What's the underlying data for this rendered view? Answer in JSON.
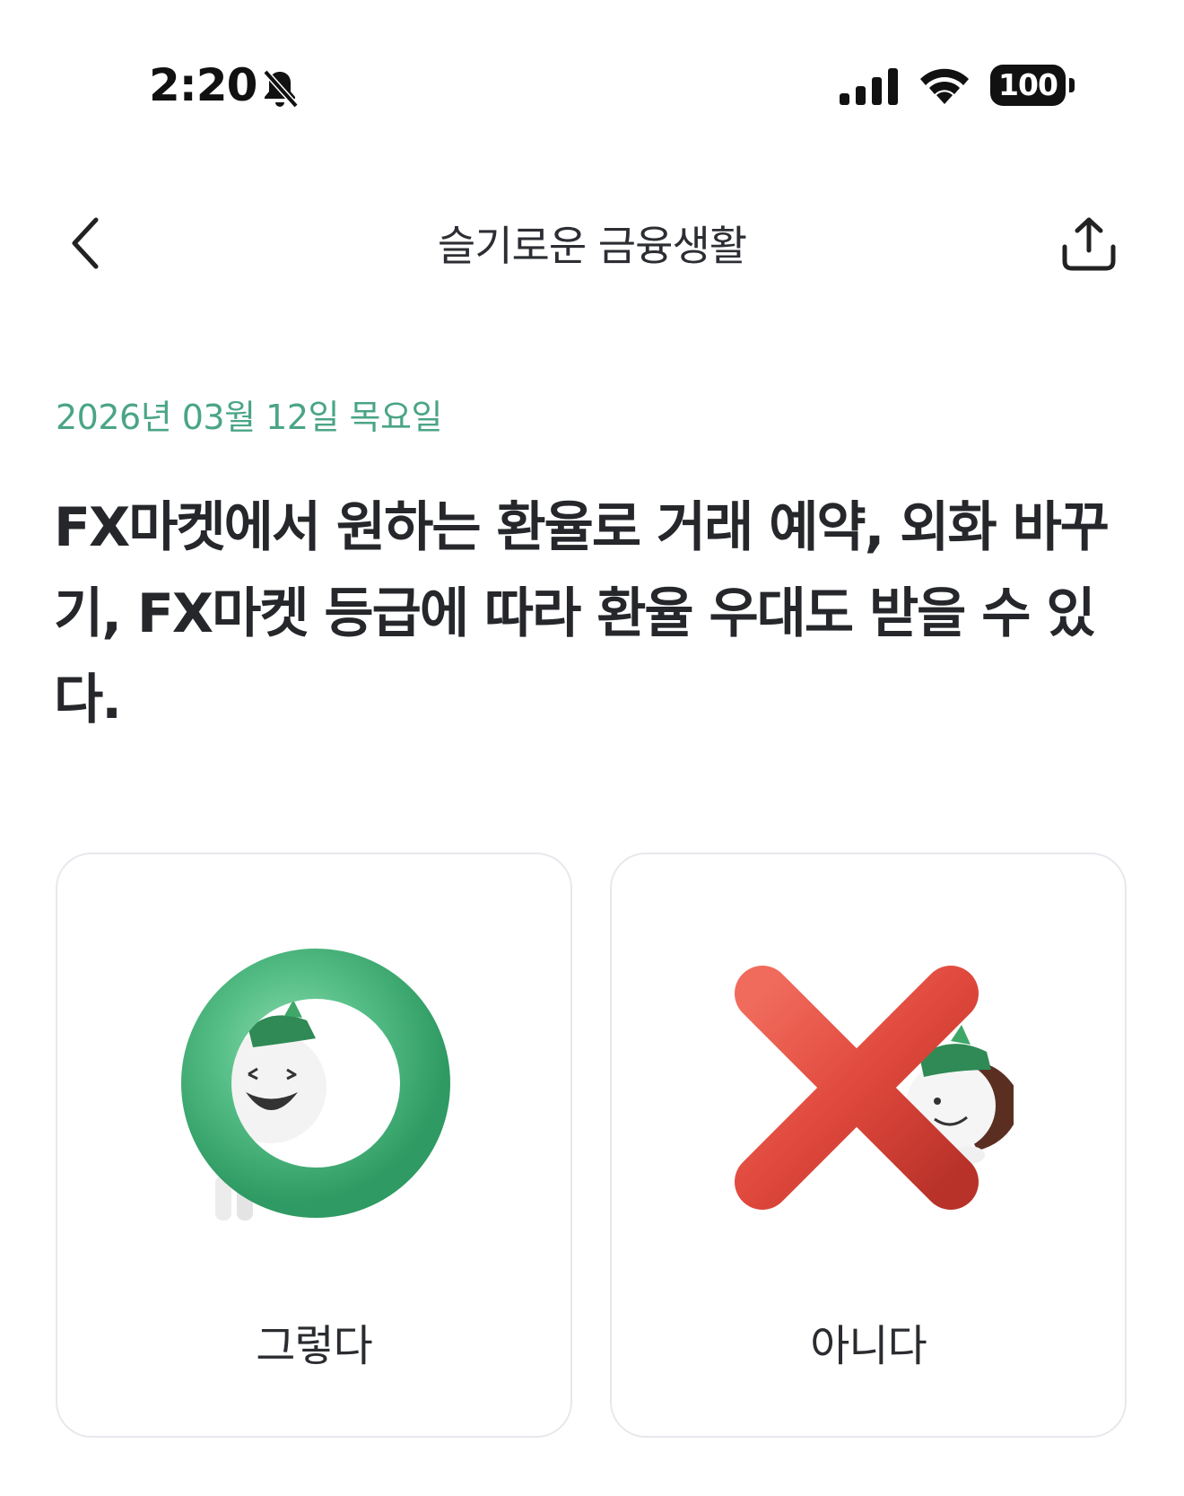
{
  "status_bar": {
    "time": "2:20",
    "battery": "100"
  },
  "header": {
    "title": "슬기로운 금융생활"
  },
  "quiz": {
    "date": "2026년 03월 12일 목요일",
    "question": "FX마켓에서 원하는 환율로 거래 예약, 외화 바꾸기, FX마켓 등급에 따라 환율 우대도 받을 수 있다.",
    "answers": [
      {
        "label": "그렇다",
        "icon": "o-mark-character-icon",
        "color": "#55be86"
      },
      {
        "label": "아니다",
        "icon": "x-mark-character-icon",
        "color": "#e0483c"
      }
    ]
  }
}
